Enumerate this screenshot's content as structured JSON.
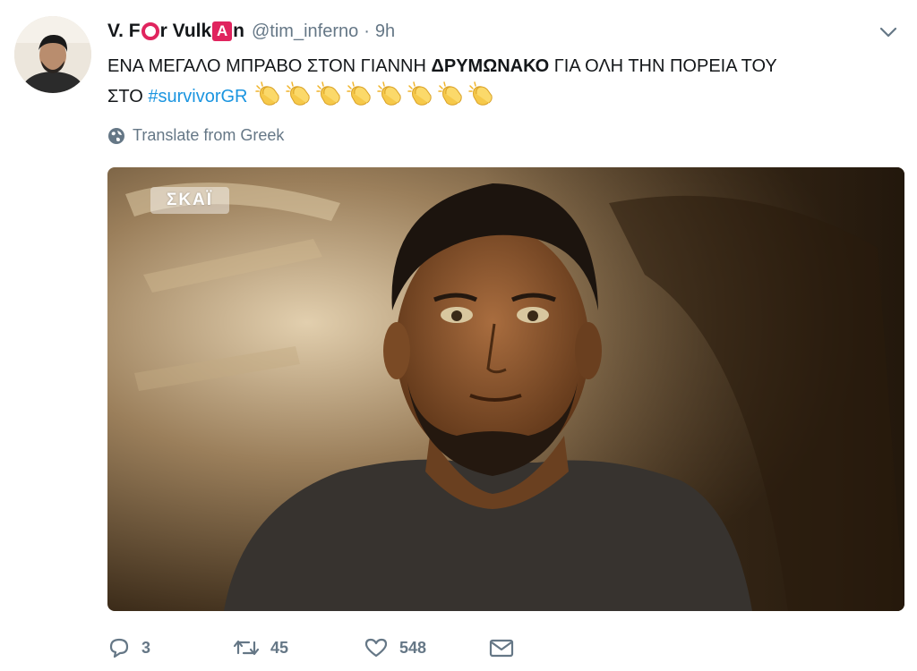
{
  "author": {
    "name_parts": [
      "V. F",
      "O",
      "r Vulk",
      "A",
      "n"
    ],
    "handle": "@tim_inferno",
    "separator": "·",
    "time": "9h"
  },
  "tweet": {
    "line1_start": "ΕΝΑ ΜΕΓΑΛΟ ΜΠΡΑΒΟ ΣΤΟΝ ΓΙΑΝΝΗ ",
    "line1_bold": "ΔΡΥΜΩΝΑΚΟ",
    "line1_end": " ΓΙΑ ΟΛΗ ΤΗΝ ΠΟΡΕΙΑ ΤΟΥ",
    "line2_start": "ΣΤΟ ",
    "hashtag": "#survivorGR",
    "emoji_name": "clapping-hands",
    "emoji_count": 8
  },
  "translate": {
    "icon": "globe-icon",
    "label": "Translate from Greek"
  },
  "media": {
    "watermark": "ΣΚΑΪ"
  },
  "actions": {
    "reply_count": "3",
    "retweet_count": "45",
    "like_count": "548"
  },
  "colors": {
    "accent": "#1b95e0",
    "muted": "#657786",
    "logo_red": "#e0245e"
  }
}
